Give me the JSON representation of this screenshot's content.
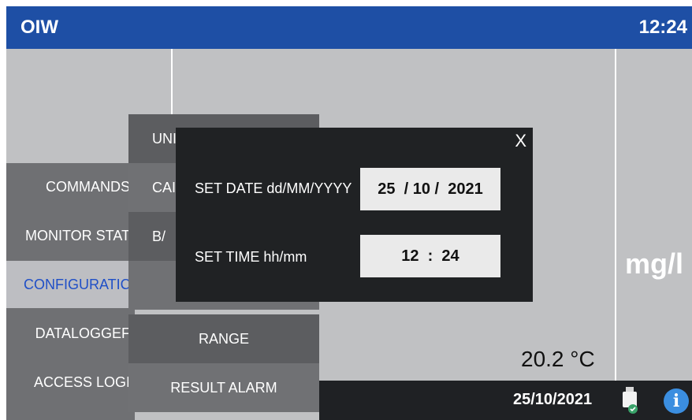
{
  "header": {
    "title": "OIW",
    "time": "12:24"
  },
  "display": {
    "unit": "mg/l",
    "temperature": "20.2 °C"
  },
  "footer": {
    "date": "25/10/2021",
    "usb_icon": "usb-drive-icon",
    "info_icon": "info-icon",
    "info_glyph": "i"
  },
  "main_menu": [
    {
      "label": "COMMANDS",
      "active": false
    },
    {
      "label": "MONITOR STAT",
      "active": false
    },
    {
      "label": "CONFIGURATIC",
      "active": true
    },
    {
      "label": "DATALOGGEF",
      "active": false
    },
    {
      "label": "ACCESS LOGI",
      "active": false
    }
  ],
  "sub_menu": [
    {
      "label": "UNI"
    },
    {
      "label": "CAI"
    },
    {
      "label": "B/"
    },
    {
      "label": ""
    },
    {
      "label": "RANGE"
    },
    {
      "label": "RESULT ALARM"
    }
  ],
  "dialog": {
    "close_label": "X",
    "date_label": "SET DATE dd/MM/YYYY",
    "date_value": "25  / 10 /  2021",
    "time_label": "SET TIME hh/mm",
    "time_value": "12  :  24"
  },
  "colors": {
    "header": "#1e4fa5",
    "active_menu_text": "#1f4fc7",
    "dialog": "#202224"
  }
}
